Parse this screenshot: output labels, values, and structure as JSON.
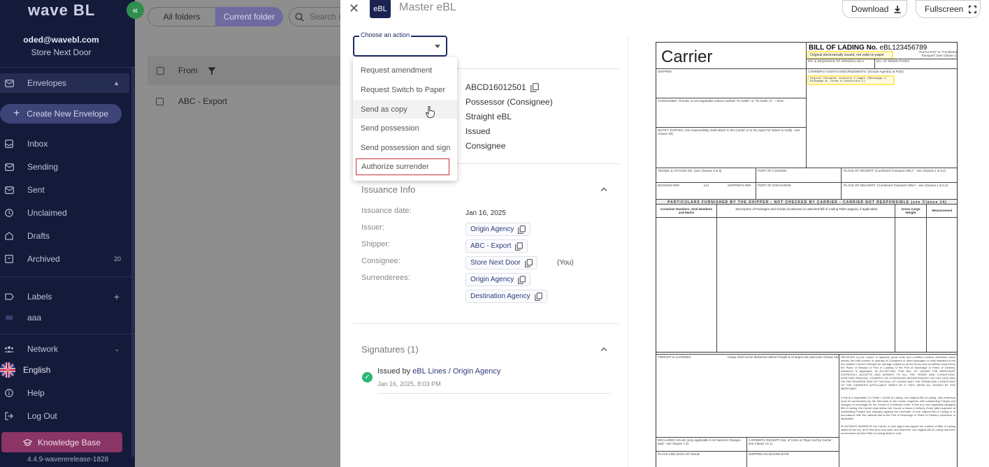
{
  "sidebar": {
    "logo": "wave BL",
    "collapse_icon": "«",
    "email": "oded@wavebl.com",
    "org": "Store Next Door",
    "envelopes": "Envelopes",
    "create_new": "Create New Envelope",
    "items": {
      "inbox": "Inbox",
      "sending": "Sending",
      "sent": "Sent",
      "unclaimed": "Unclaimed",
      "drafts": "Drafts",
      "archived": "Archived",
      "archived_count": "20"
    },
    "labels": "Labels",
    "label_aaa": "aaa",
    "network": "Network",
    "language": "English",
    "help": "Help",
    "logout": "Log Out",
    "knowledge_base": "Knowledge Base",
    "version": "4.4.9-wavererelease-1828"
  },
  "list": {
    "all_folders": "All folders",
    "current_folder": "Current folder",
    "search_placeholder": "Search i",
    "header_from": "From",
    "row_name": "ABC - Export"
  },
  "panel": {
    "badge": "eBL",
    "title": "Master eBL",
    "download": "Download",
    "fullscreen": "Fullscreen",
    "action_label": "Choose an action",
    "menu": [
      "Request amendment",
      "Request Switch to Paper",
      "Send as copy",
      "Send possession",
      "Send possession and sign",
      "Authorize surrender"
    ],
    "details": {
      "number": "ABCD16012501",
      "role": "Possessor (Consignee)",
      "type": "Straight eBL",
      "status": "Issued",
      "party": "Consignee"
    },
    "issuance": {
      "title": "Issuance Info",
      "date_label": "Issuance date:",
      "date": "Jan 16, 2025",
      "issuer_label": "Issuer:",
      "issuer": "Origin Agency",
      "shipper_label": "Shipper:",
      "shipper": "ABC - Export",
      "consignee_label": "Consignee:",
      "consignee": "Store Next Door",
      "you": "(You)",
      "surrenderees_label": "Surrenderees:",
      "surrenderee_1": "Origin Agency",
      "surrenderee_2": "Destination Agency"
    },
    "signatures": {
      "title": "Signatures (1)",
      "issued_by": "Issued by",
      "signer": "eBL Lines / Origin Agency",
      "timestamp": "Jan 16, 2025, 8:03 PM"
    }
  },
  "doc": {
    "carrier": "Carrier",
    "bol_label": "BILL OF LADING No.",
    "bol_number": "eBL123456789",
    "original_note": "Original electronically issued, not valid on paper",
    "port_note": "\"Port-to-Port\" or \"Combined Transport\" (see Clause 1)",
    "no_seq": "NO. & SEQUENCE OF ORIGINAL B/L's",
    "rider": "NO. OF RIDER PAGES",
    "shipper": "SHIPPER:",
    "agents": "CARRIER'S AGENTS ENDORSEMENTS: (Include Agent(s) at POD)",
    "digital_note": "Digital Document contains 2 pages (Mainpage-1, Ridepage-N, Terms & Conditions-1)",
    "consignee": "CONSIGNEE: This B/L is not negotiable unless marked \"To Order\" or \"To Order of ...\" here.",
    "notify": "NOTIFY PARTIES: (No responsibility shall attach to the Carrier or to his Agent for failure to notify - see Clause 20)",
    "vessel": "VESSEL & VOYAGE NO. (see Clauses 8 & 9)",
    "port_loading": "PORT OF LOADING",
    "place_receipt": "PLACE OF RECEIPT: (Combined Transport ONLY - see Clauses 1 & 5.2)",
    "booking": "BOOKING REF.",
    "or": "(or)",
    "shippers_ref": "SHIPPER'S REF.",
    "port_discharge": "PORT OF DISCHARGE",
    "place_delivery": "PLACE OF DELIVERY: (Combined Transport ONLY - see Clauses 1 & 5.2)",
    "band": "PARTICULARS FURNISHED BY THE SHIPPER - NOT CHECKED BY CARRIER - CARRIER NOT RESPONSIBLE (see Clause 14)",
    "container": "Container Numbers, Seal Numbers and Marks",
    "description": "Description of Packages and Goods (Continued on attached Bill of Lading Rider page(s), if applicable)",
    "gross": "Gross Cargo Weight",
    "measurement": "Measurement",
    "freight": "FREIGHT & CHARGES",
    "cargo_note": "Cargo shall not be delivered unless Freight & Charges are paid (see Clause 16).",
    "received_text": "RECEIVED by the Carrier in apparent good order and condition (unless otherwise noted herein) the total number or quantity of Containers or other packages or units indicated in the box entitled Carrier's Receipt for carriage subject to all the terms and conditions hereof from the Place of Receipt or Port of Loading to the Port of Discharge or Place of Delivery, whichever is applicable. IN ACCEPTING THIS BILL OF LADING THE MERCHANT EXPRESSLY ACCEPTS AND AGREES TO ALL THE TERMS AND CONDITIONS, WHETHER PRINTED, STAMPED OR OTHERWISE INCORPORATED ON THIS SIDE AND ON THE REVERSE SIDE OF THIS BILL OF LADING AND THE TERMS AND CONDITIONS OF THE CARRIER'S APPLICABLE TARIFF AS IF THEY WERE ALL SIGNED BY THE MERCHANT.",
    "negotiable_text": "If this is a negotiable (To Order / of) Bill of Lading, one original Bill of Lading, duly endorsed must be surrendered by the Merchant to the Carrier (together with outstanding Freight and charges) in exchange for the Goods or a Delivery Order. If this is a non-negotiable (straight) Bill of Lading, the Carrier shall deliver the Goods or issue a Delivery Order (after payment of outstanding Freight and charges) against the surrender of one original Bill of Lading or in accordance with the national law at the Port of Discharge or Place of Delivery whichever is applicable.",
    "witness_text": "IN WITNESS WHEREOF the Carrier or their Agent has signed the number of Bills of Lading stated at the top, all of this tenor and date, and wherever one original Bill of Lading has been surrendered all other Bills of Lading shall be void.",
    "declared": "DECLARED VALUE (only applicable if Ad Valorem Charges paid - see Clause 7.3)",
    "carriers_receipt": "CARRIER'S RECEIPT (No. of Cntrs or Pkgs rcvd by Carrier - see Clause 14.1)",
    "place_issue": "PLACE AND DATE OF ISSUE",
    "shipped": "SHIPPED ON BOARD DATE"
  },
  "colors": {
    "sidebar_bg": "#141a3a",
    "brand_green": "#2f8f4e",
    "knowledge_base": "#8a3566",
    "navy": "#1b2352",
    "outline_red": "#c5323b",
    "highlight_yellow": "#ffe96a"
  }
}
